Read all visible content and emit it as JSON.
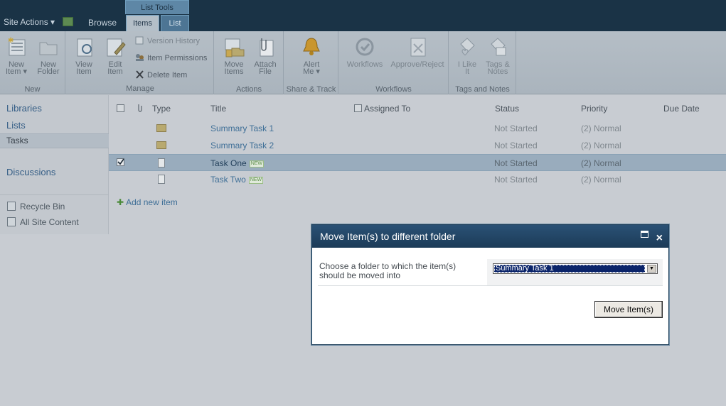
{
  "topbar": {
    "site_actions": "Site Actions ▾",
    "tab_browse": "Browse",
    "context_group": "List Tools",
    "tab_items": "Items",
    "tab_list": "List"
  },
  "ribbon": {
    "groups": {
      "new": "New",
      "manage": "Manage",
      "actions": "Actions",
      "share": "Share & Track",
      "workflows": "Workflows",
      "tags": "Tags and Notes"
    },
    "buttons": {
      "new_item_1": "New",
      "new_item_2": "Item ▾",
      "new_folder_1": "New",
      "new_folder_2": "Folder",
      "view_item_1": "View",
      "view_item_2": "Item",
      "edit_item_1": "Edit",
      "edit_item_2": "Item",
      "version_history": "Version History",
      "item_permissions": "Item Permissions",
      "delete_item": "Delete Item",
      "move_items_1": "Move",
      "move_items_2": "Items",
      "attach_file_1": "Attach",
      "attach_file_2": "File",
      "alert_me_1": "Alert",
      "alert_me_2": "Me ▾",
      "workflows": "Workflows",
      "approve_reject": "Approve/Reject",
      "i_like_it_1": "I Like",
      "i_like_it_2": "It",
      "tags_notes_1": "Tags &",
      "tags_notes_2": "Notes"
    }
  },
  "leftnav": {
    "libraries": "Libraries",
    "lists": "Lists",
    "tasks": "Tasks",
    "discussions": "Discussions",
    "recycle_bin": "Recycle Bin",
    "all_site_content": "All Site Content"
  },
  "list": {
    "columns": {
      "type": "Type",
      "title": "Title",
      "assigned_to": "Assigned To",
      "status": "Status",
      "priority": "Priority",
      "due_date": "Due Date"
    },
    "new_badge": "NEW",
    "rows": [
      {
        "title": "Summary Task 1",
        "status": "Not Started",
        "priority": "(2) Normal"
      },
      {
        "title": "Summary Task 2",
        "status": "Not Started",
        "priority": "(2) Normal"
      },
      {
        "title": "Task One",
        "status": "Not Started",
        "priority": "(2) Normal"
      },
      {
        "title": "Task Two",
        "status": "Not Started",
        "priority": "(2) Normal"
      }
    ],
    "add_new_item": "Add new item"
  },
  "dialog": {
    "title": "Move Item(s) to different folder",
    "label": "Choose a folder to which the item(s) should be moved into",
    "selected_folder": "Summary Task 1",
    "move_button": "Move Item(s)"
  }
}
